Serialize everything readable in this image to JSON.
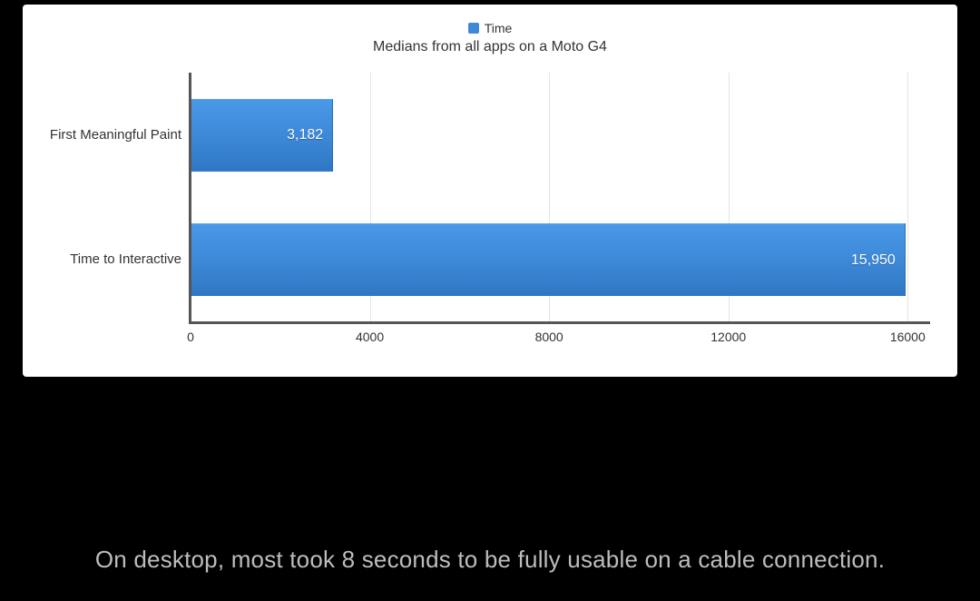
{
  "chart_data": {
    "type": "bar",
    "orientation": "horizontal",
    "title": "Medians from all apps on a Moto G4",
    "legend": {
      "series_name": "Time"
    },
    "categories": [
      "First Meaningful Paint",
      "Time to Interactive"
    ],
    "values": [
      3182,
      15950
    ],
    "value_labels": [
      "3,182",
      "15,950"
    ],
    "x_ticks": [
      0,
      4000,
      8000,
      12000,
      16000
    ],
    "x_tick_labels": [
      "0",
      "4000",
      "8000",
      "12000",
      "16000"
    ],
    "xlim": [
      0,
      16500
    ],
    "grid": true,
    "bar_color": "#3d89d8"
  },
  "caption": "On desktop, most took 8 seconds to be fully usable on a cable connection."
}
